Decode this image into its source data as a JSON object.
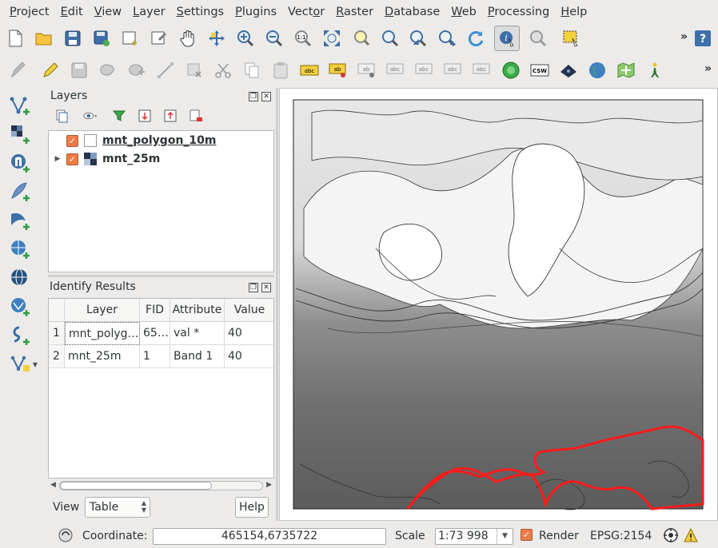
{
  "menubar": {
    "items": [
      {
        "label": "Project",
        "mnemonic": "P",
        "rest": "roject"
      },
      {
        "label": "Edit",
        "mnemonic": "E",
        "rest": "dit"
      },
      {
        "label": "View",
        "mnemonic": "V",
        "rest": "iew"
      },
      {
        "label": "Layer",
        "mnemonic": "L",
        "rest": "ayer"
      },
      {
        "label": "Settings",
        "mnemonic": "S",
        "rest": "ettings"
      },
      {
        "label": "Plugins",
        "mnemonic": "P",
        "rest": "lugins"
      },
      {
        "label": "Vector",
        "mnemonic": "o",
        "pre": "Vect",
        "rest": "r"
      },
      {
        "label": "Raster",
        "mnemonic": "R",
        "rest": "aster"
      },
      {
        "label": "Database",
        "mnemonic": "D",
        "rest": "atabase"
      },
      {
        "label": "Web",
        "mnemonic": "W",
        "rest": "eb"
      },
      {
        "label": "Processing",
        "mnemonic": "P",
        "rest": "rocessing"
      },
      {
        "label": "Help",
        "mnemonic": "H",
        "rest": "elp"
      }
    ]
  },
  "toolbar_more": "»",
  "icons": {
    "toolbar1": [
      "new-project-icon",
      "open-project-icon",
      "save-project-icon",
      "save-as-icon",
      "new-print-composer-icon",
      "composer-manager-icon",
      "pan-icon",
      "pan-to-selection-icon",
      "zoom-in-icon",
      "zoom-out-icon",
      "zoom-native-icon",
      "zoom-full-icon",
      "zoom-to-selection-icon",
      "zoom-to-layer-icon",
      "zoom-last-icon",
      "zoom-next-icon",
      "refresh-icon",
      "identify-icon",
      "map-tips-icon",
      "select-features-icon",
      "help-contents-icon"
    ],
    "toolbar2": [
      "digitize-icon",
      "toggle-edit-icon",
      "save-edits-icon",
      "add-feature-icon",
      "move-feature-icon",
      "node-tool-icon",
      "delete-selected-icon",
      "cut-features-icon",
      "copy-features-icon",
      "paste-features-icon",
      "label-tool-icon",
      "pin-labels-icon",
      "show-hide-labels-icon",
      "move-label-icon",
      "rotate-label-icon",
      "change-label-icon",
      "gps-icon",
      "csw-icon",
      "metasearch-icon",
      "globe-icon",
      "georeferencer-icon",
      "python-icon"
    ],
    "vertical": [
      "add-vector-layer-icon",
      "add-raster-layer-icon",
      "add-postgis-layer-icon",
      "add-spatialite-layer-icon",
      "add-mssql-layer-icon",
      "add-wms-layer-icon",
      "add-wcs-layer-icon",
      "add-wfs-layer-icon",
      "add-delimited-text-icon",
      "new-shapefile-icon"
    ]
  },
  "layers_panel": {
    "title": "Layers",
    "layers": [
      {
        "name": "mnt_polygon_10m",
        "checked": true,
        "icon": "polygon-layer-icon"
      },
      {
        "name": "mnt_25m",
        "checked": true,
        "icon": "raster-layer-icon"
      }
    ]
  },
  "identify_panel": {
    "title": "Identify Results",
    "columns": [
      "Layer",
      "FID",
      "Attribute",
      "Value"
    ],
    "rows": [
      {
        "num": "1",
        "layer": "mnt_polyg…",
        "fid": "65…",
        "attribute": "val *",
        "value": "40"
      },
      {
        "num": "2",
        "layer": "mnt_25m",
        "fid": "1",
        "attribute": "Band 1",
        "value": "40"
      }
    ],
    "view_label": "View",
    "view_value": "Table",
    "help_label": "Help",
    "scroll_position": 0.0
  },
  "statusbar": {
    "coordinate_label": "Coordinate:",
    "coordinate_value": "465154,6735722",
    "scale_label": "Scale",
    "scale_value": "1:73 998",
    "render_label": "Render",
    "render_checked": true,
    "crs": "EPSG:2154"
  },
  "colors": {
    "accent": "#f07a46",
    "highlight": "#ff0000",
    "window_bg": "#ecebe9"
  }
}
